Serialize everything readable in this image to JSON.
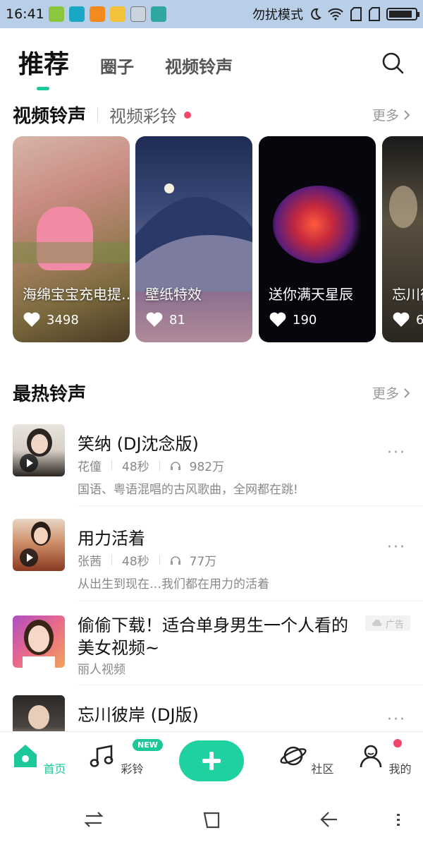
{
  "status": {
    "time": "16:41",
    "mode": "勿扰模式",
    "battery_level": 0.9
  },
  "tabs": [
    "推荐",
    "圈子",
    "视频铃声"
  ],
  "video_section": {
    "title": "视频铃声",
    "subtitle": "视频彩铃",
    "more": "更多",
    "cards": [
      {
        "title": "海绵宝宝充电提…",
        "likes": "3498"
      },
      {
        "title": "壁纸特效",
        "likes": "81"
      },
      {
        "title": "送你满天星辰",
        "likes": "190"
      },
      {
        "title": "忘川彼",
        "likes": "6"
      }
    ]
  },
  "hot_section": {
    "title": "最热铃声",
    "more": "更多",
    "songs": [
      {
        "name": "笑纳 (DJ沈念版)",
        "artist": "花僮",
        "duration": "48秒",
        "plays": "982万",
        "desc": "国语、粤语混唱的古风歌曲，全网都在跳!"
      },
      {
        "name": "用力活着",
        "artist": "张茜",
        "duration": "48秒",
        "plays": "77万",
        "desc": "从出生到现在…我们都在用力的活着"
      },
      {
        "name": "忘川彼岸 (DJ版)",
        "artist": "",
        "duration": "",
        "plays": "",
        "desc": ""
      }
    ],
    "ad": {
      "title": "偷偷下载！适合单身男生一个人看的美女视频~",
      "source": "丽人视频",
      "badge": "广告"
    }
  },
  "bottom_nav": {
    "home": "首页",
    "ringtone": "彩铃",
    "new_badge": "NEW",
    "community": "社区",
    "mine": "我的"
  },
  "colors": {
    "accent": "#1cc79a",
    "red": "#f3466b"
  }
}
